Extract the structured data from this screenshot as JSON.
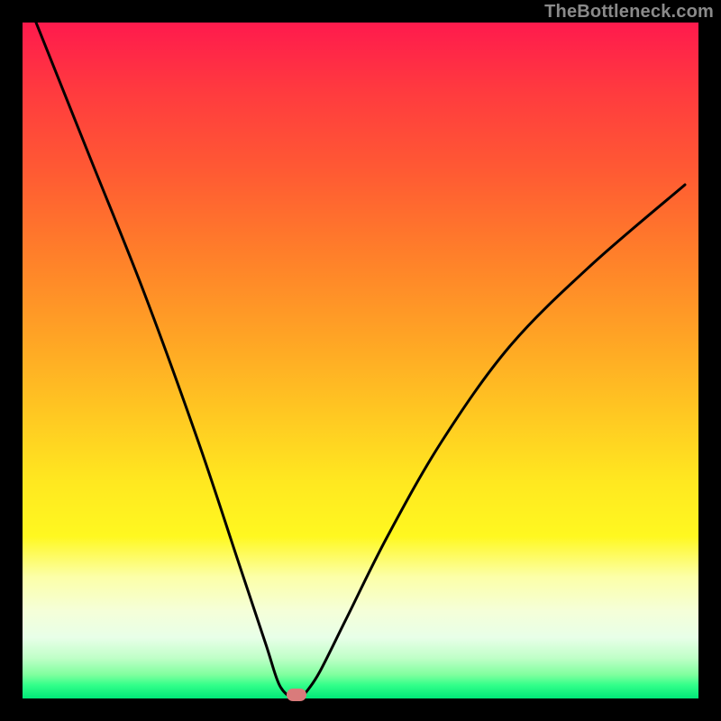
{
  "watermark": "TheBottleneck.com",
  "chart_data": {
    "type": "line",
    "title": "",
    "xlabel": "",
    "ylabel": "",
    "xlim": [
      0,
      100
    ],
    "ylim": [
      0,
      100
    ],
    "grid": false,
    "series": [
      {
        "name": "bottleneck-curve",
        "x": [
          2,
          10,
          18,
          26,
          32,
          36,
          38,
          40,
          41,
          42,
          44,
          48,
          54,
          62,
          72,
          84,
          98
        ],
        "values": [
          100,
          80,
          60,
          38,
          20,
          8,
          2,
          0,
          0,
          1,
          4,
          12,
          24,
          38,
          52,
          64,
          76
        ]
      }
    ],
    "optimum_marker_x": 40.5,
    "optimum_marker_y": 0,
    "colors": {
      "top": "#ff1a4d",
      "mid": "#ffe820",
      "bottom": "#00e878",
      "curve": "#000000",
      "marker": "#d97b7b",
      "frame": "#000000"
    }
  }
}
